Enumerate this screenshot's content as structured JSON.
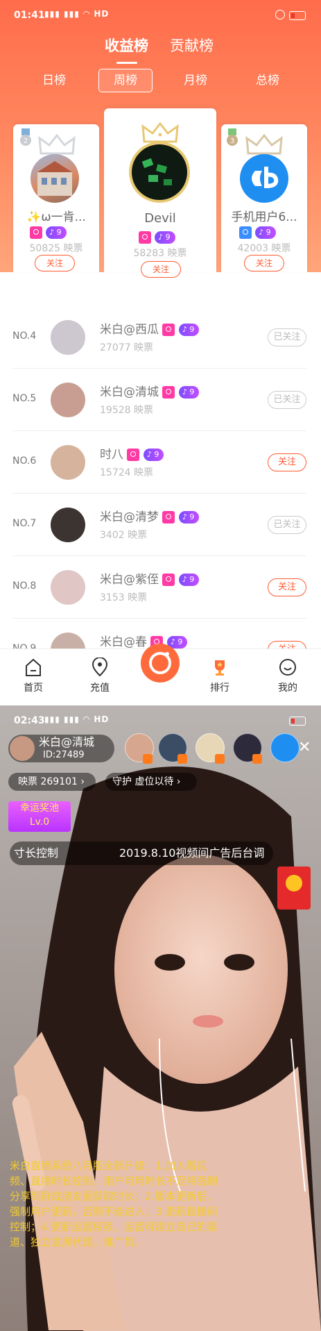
{
  "status_bar_1": {
    "time": "01:41",
    "signal": "ֈֈ 4G",
    "network": "HD"
  },
  "status_bar_2": {
    "time": "02:43",
    "signal": "ֈֈ 4G",
    "network": "HD"
  },
  "ranking_tabs": [
    {
      "label": "收益榜",
      "active": true
    },
    {
      "label": "贡献榜",
      "active": false
    }
  ],
  "periods": [
    {
      "label": "日榜",
      "active": false
    },
    {
      "label": "周榜",
      "active": true
    },
    {
      "label": "月榜",
      "active": false
    },
    {
      "label": "总榜",
      "active": false
    }
  ],
  "podium": [
    {
      "rank": "2",
      "name": "✨ω一肯...",
      "name_short": "肯...",
      "level": "9",
      "score": "50825 映票",
      "follow": "关注",
      "medal_color": "#8fb7d4",
      "badge_color": "#ff3aa5"
    },
    {
      "rank": "1",
      "name": "Devil",
      "level": "9",
      "score": "58283 映票",
      "follow": "关注",
      "medal_color": "#e9c46a",
      "badge_color": "#ff3aa5"
    },
    {
      "rank": "3",
      "name": "手机用户6...",
      "level": "9",
      "score": "42003 映票",
      "follow": "关注",
      "medal_color": "#7cc576",
      "badge_color": "#3b8cff"
    }
  ],
  "list": [
    {
      "rank": "NO.4",
      "name": "米白@西瓜",
      "level": "9",
      "score": "27077 映票",
      "button": "已关注",
      "followed": true
    },
    {
      "rank": "NO.5",
      "name": "米白@清城",
      "level": "9",
      "score": "19528 映票",
      "button": "已关注",
      "followed": true
    },
    {
      "rank": "NO.6",
      "name": "时八",
      "level": "9",
      "score": "15724 映票",
      "button": "关注",
      "followed": false
    },
    {
      "rank": "NO.7",
      "name": "米白@清梦",
      "level": "9",
      "score": "3402 映票",
      "button": "已关注",
      "followed": true
    },
    {
      "rank": "NO.8",
      "name": "米白@紫侄",
      "level": "9",
      "score": "3153 映票",
      "button": "关注",
      "followed": false
    },
    {
      "rank": "NO.9",
      "name": "米白@春",
      "level": "9",
      "score": "",
      "button": "关注",
      "followed": false
    }
  ],
  "nav": [
    {
      "label": "首页",
      "icon": "home-icon"
    },
    {
      "label": "充值",
      "icon": "location-icon"
    },
    {
      "label": "",
      "icon": "camera-icon"
    },
    {
      "label": "排行",
      "icon": "trophy-icon"
    },
    {
      "label": "我的",
      "icon": "profile-icon"
    }
  ],
  "live": {
    "host_name": "米白@清城",
    "host_id": "ID:27489",
    "tickets_label": "映票",
    "tickets_value": "269101",
    "guard_label": "守护",
    "guard_value": "虚位以待",
    "lucky_label": "幸运奖池",
    "lucky_level": "Lv.0",
    "marquee_left": "寸长控制",
    "marquee_right": "2019.8.10视频间广告后台调",
    "announcement": "米白直播系统八月版全新升级：1.加入看视频、直播时长控制，用户可用时长不足将强制分享到群或朋友圈获取时长；2.版本更新后，强制用户更新，否则不能进入；3.更新直播间控制；4.更新运营权限，运营可建立自己的渠道、独立发展代理，推广员。",
    "accent": "#ff7a1a"
  }
}
